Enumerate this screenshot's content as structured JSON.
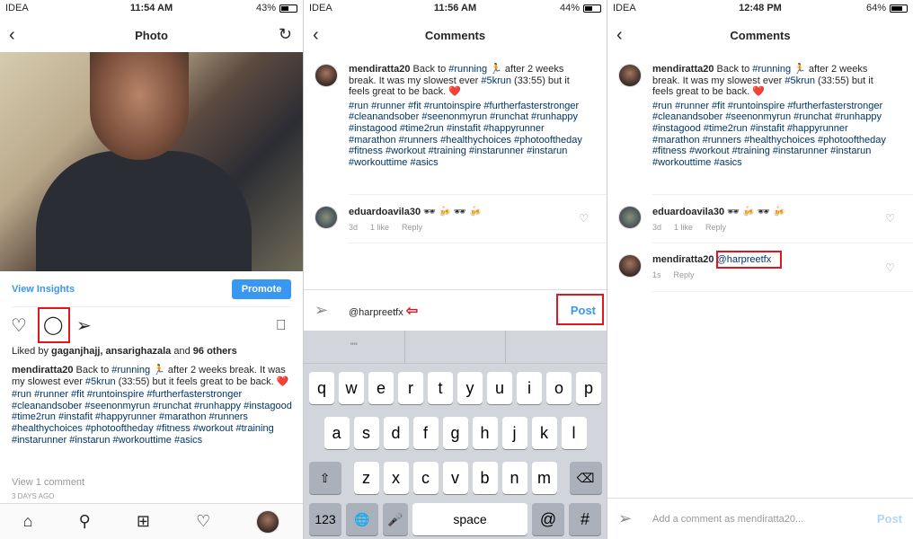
{
  "screens": [
    {
      "status": {
        "carrier": "IDEA",
        "time": "11:54 AM",
        "battery": "43%",
        "battery_level": 43
      },
      "title": "Photo"
    },
    {
      "status": {
        "carrier": "IDEA",
        "time": "11:56 AM",
        "battery": "44%",
        "battery_level": 44
      },
      "title": "Comments"
    },
    {
      "status": {
        "carrier": "IDEA",
        "time": "12:48 PM",
        "battery": "64%",
        "battery_level": 64
      },
      "title": "Comments"
    }
  ],
  "post": {
    "view_insights": "View Insights",
    "promote": "Promote",
    "liked_by_prefix": "Liked by ",
    "liked_users": "gaganjhajj, ansarighazala",
    "liked_and": " and ",
    "liked_others": "96 others",
    "username": "mendiratta20",
    "cap1": " Back to ",
    "tag_running": "#running",
    "cap2": " 🏃 after 2 weeks break. It was my slowest ever ",
    "tag_5k": "#5krun",
    "cap3": " (33:55) but it feels great to be back. ❤️",
    "hashtags": "#run #runner #fit #runtoinspire #furtherfasterstronger #cleanandsober #seenonmyrun #runchat #runhappy #instagood #time2run #instafit #happyrunner #marathon #runners #healthychoices #photooftheday #fitness #workout  #training #instarunner #instarun #workouttime #asics",
    "view_comments": "View 1 comment",
    "time_ago": "3 DAYS AGO"
  },
  "comments": [
    {
      "user": "eduardoavila30",
      "text": " 🕶 🍻 🕶 🍻",
      "time": "3d",
      "likes": "1 like",
      "reply": "Reply"
    },
    {
      "user": "mendiratta20",
      "mention": "@harpreetfx",
      "time": "1s",
      "reply": "Reply"
    }
  ],
  "composer": {
    "typed": "@harpreetfx",
    "post": "Post",
    "placeholder": "Add a comment as mendiratta20..."
  },
  "keyboard": {
    "suggestions": [
      "\"\"",
      "",
      ""
    ],
    "row1": [
      "q",
      "w",
      "e",
      "r",
      "t",
      "y",
      "u",
      "i",
      "o",
      "p"
    ],
    "row2": [
      "a",
      "s",
      "d",
      "f",
      "g",
      "h",
      "j",
      "k",
      "l"
    ],
    "row3": [
      "z",
      "x",
      "c",
      "v",
      "b",
      "n",
      "m"
    ],
    "numbers": "123",
    "space": "space",
    "at": "@",
    "hash": "#"
  },
  "accent_color": "#3897f0",
  "highlight_color": "#e0161f"
}
